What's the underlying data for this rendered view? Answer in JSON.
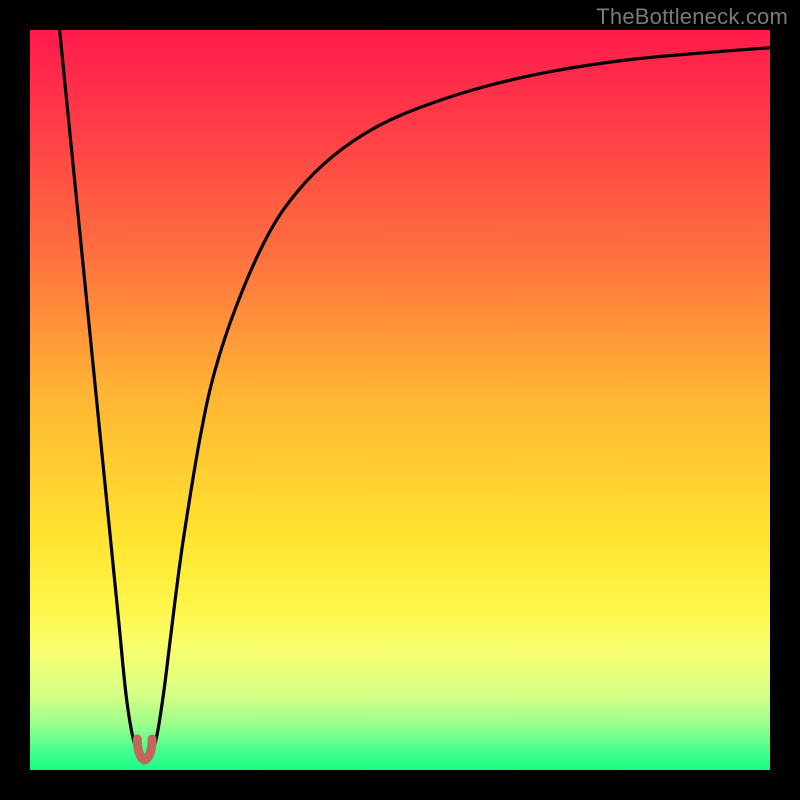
{
  "watermark": "TheBottleneck.com",
  "chart_data": {
    "type": "line",
    "title": "",
    "xlabel": "",
    "ylabel": "",
    "xlim": [
      0,
      100
    ],
    "ylim": [
      0,
      100
    ],
    "gradient_stops": [
      {
        "offset": 0,
        "color": "#ff1a4b"
      },
      {
        "offset": 0.12,
        "color": "#ff3a48"
      },
      {
        "offset": 0.3,
        "color": "#ff6f3f"
      },
      {
        "offset": 0.5,
        "color": "#ffb733"
      },
      {
        "offset": 0.68,
        "color": "#ffe22f"
      },
      {
        "offset": 0.78,
        "color": "#fff64a"
      },
      {
        "offset": 0.84,
        "color": "#f7ff6f"
      },
      {
        "offset": 0.9,
        "color": "#d4ff86"
      },
      {
        "offset": 0.94,
        "color": "#98ff8d"
      },
      {
        "offset": 0.97,
        "color": "#4dff8d"
      },
      {
        "offset": 1.0,
        "color": "#18ff85"
      }
    ],
    "series": [
      {
        "name": "bottleneck-curve",
        "x": [
          4,
          5,
          6,
          7,
          8,
          9,
          10,
          11,
          12,
          13,
          14,
          15,
          16,
          17,
          18,
          19,
          20,
          21,
          23,
          25,
          28,
          32,
          36,
          41,
          47,
          54,
          62,
          71,
          81,
          92,
          100
        ],
        "y": [
          100,
          90,
          80,
          70,
          60,
          50,
          40,
          30,
          20,
          10,
          4,
          2,
          2,
          4,
          10,
          18,
          26,
          33,
          45,
          54,
          63,
          72,
          78,
          83,
          87,
          90,
          92.5,
          94.5,
          96,
          97,
          97.6
        ]
      }
    ],
    "minimum_marker": {
      "x_range": [
        14.5,
        16.5
      ],
      "y": 2,
      "color": "#c1675b"
    },
    "annotations": []
  }
}
